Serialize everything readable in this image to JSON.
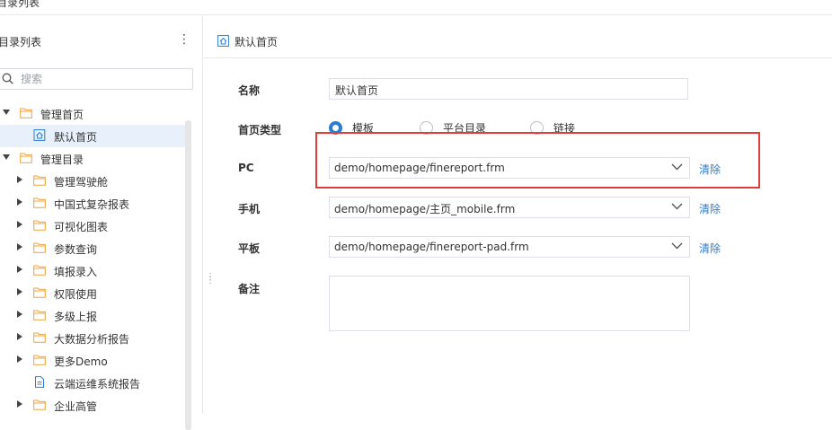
{
  "app": {
    "title": "目录列表"
  },
  "sidebar": {
    "title": "目录列表",
    "search_placeholder": "搜索",
    "items": [
      {
        "label": "管理首页",
        "level": 0,
        "expanded": true,
        "icon": "folder-icon"
      },
      {
        "label": "默认首页",
        "level": 1,
        "icon": "home-icon",
        "selected": true
      },
      {
        "label": "管理目录",
        "level": 0,
        "expanded": true,
        "icon": "folder-icon"
      },
      {
        "label": "管理驾驶舱",
        "level": 1,
        "expanded": false,
        "icon": "folder-icon"
      },
      {
        "label": "中国式复杂报表",
        "level": 1,
        "expanded": false,
        "icon": "folder-icon"
      },
      {
        "label": "可视化图表",
        "level": 1,
        "expanded": false,
        "icon": "folder-icon"
      },
      {
        "label": "参数查询",
        "level": 1,
        "expanded": false,
        "icon": "folder-icon"
      },
      {
        "label": "填报录入",
        "level": 1,
        "expanded": false,
        "icon": "folder-icon"
      },
      {
        "label": "权限使用",
        "level": 1,
        "expanded": false,
        "icon": "folder-icon"
      },
      {
        "label": "多级上报",
        "level": 1,
        "expanded": false,
        "icon": "folder-icon"
      },
      {
        "label": "大数据分析报告",
        "level": 1,
        "expanded": false,
        "icon": "folder-icon"
      },
      {
        "label": "更多Demo",
        "level": 1,
        "expanded": false,
        "icon": "folder-icon"
      },
      {
        "label": "云端运维系统报告",
        "level": 1,
        "icon": "document-icon"
      },
      {
        "label": "企业高管",
        "level": 1,
        "expanded": false,
        "icon": "folder-icon"
      }
    ]
  },
  "main": {
    "breadcrumb": "默认首页",
    "form": {
      "name_label": "名称",
      "name_value": "默认首页",
      "type_label": "首页类型",
      "type_options": [
        "模板",
        "平台目录",
        "链接"
      ],
      "type_selected": "模板",
      "pc_label": "PC",
      "pc_value": "demo/homepage/finereport.frm",
      "mobile_label": "手机",
      "mobile_value": "demo/homepage/主页_mobile.frm",
      "tablet_label": "平板",
      "tablet_value": "demo/homepage/finereport-pad.frm",
      "clear_label": "清除",
      "remark_label": "备注",
      "remark_value": ""
    }
  },
  "colors": {
    "accent": "#2b7cd3",
    "highlight": "#e23b3b",
    "folder": "#f0a23b"
  }
}
